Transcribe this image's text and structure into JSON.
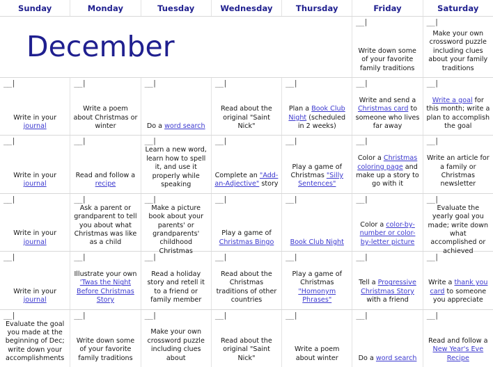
{
  "title": "December",
  "weekday_headers": [
    "Sunday",
    "Monday",
    "Tuesday",
    "Wednesday",
    "Thursday",
    "Friday",
    "Saturday"
  ],
  "date_marker": "__|",
  "colors": {
    "title": "#1f1f8f",
    "weekday_header": "#1f1f8f",
    "link": "#3b38cf",
    "body_text": "#151515",
    "grid_line": "#d8d8d8",
    "background": "#ffffff"
  },
  "weeks": [
    {
      "title_span": true,
      "days": [
        {
          "has_date": false,
          "parts": []
        },
        {
          "has_date": false,
          "parts": []
        },
        {
          "has_date": false,
          "parts": []
        },
        {
          "has_date": false,
          "parts": []
        },
        {
          "has_date": false,
          "parts": []
        },
        {
          "has_date": true,
          "parts": [
            {
              "t": "Write down some of your favorite family traditions",
              "link": false
            }
          ]
        },
        {
          "has_date": true,
          "parts": [
            {
              "t": "Make your own crossword puzzle including clues about your family traditions",
              "link": false
            }
          ]
        }
      ]
    },
    {
      "title_span": false,
      "days": [
        {
          "has_date": true,
          "parts": [
            {
              "t": "Write in your ",
              "link": false
            },
            {
              "t": "journal",
              "link": true
            }
          ]
        },
        {
          "has_date": true,
          "parts": [
            {
              "t": "Write a poem about Christmas or winter",
              "link": false
            }
          ]
        },
        {
          "has_date": true,
          "parts": [
            {
              "t": "Do a ",
              "link": false
            },
            {
              "t": "word search",
              "link": true
            }
          ]
        },
        {
          "has_date": true,
          "parts": [
            {
              "t": "Read about the original \"Saint Nick\"",
              "link": false
            }
          ]
        },
        {
          "has_date": true,
          "parts": [
            {
              "t": "Plan a ",
              "link": false
            },
            {
              "t": "Book Club Night",
              "link": true
            },
            {
              "t": " (scheduled in 2 weeks)",
              "link": false
            }
          ]
        },
        {
          "has_date": true,
          "parts": [
            {
              "t": "Write and send a ",
              "link": false
            },
            {
              "t": "Christmas card",
              "link": true
            },
            {
              "t": " to someone who lives far away",
              "link": false
            }
          ]
        },
        {
          "has_date": true,
          "parts": [
            {
              "t": "Write a goal",
              "link": true
            },
            {
              "t": " for this month; write a plan to accomplish the goal",
              "link": false
            }
          ]
        }
      ]
    },
    {
      "title_span": false,
      "days": [
        {
          "has_date": true,
          "parts": [
            {
              "t": "Write in your ",
              "link": false
            },
            {
              "t": "journal",
              "link": true
            }
          ]
        },
        {
          "has_date": true,
          "parts": [
            {
              "t": "Read and follow a ",
              "link": false
            },
            {
              "t": "recipe",
              "link": true
            }
          ]
        },
        {
          "has_date": true,
          "parts": [
            {
              "t": "Learn a new word, learn how to spell it, and use it properly while speaking",
              "link": false
            }
          ]
        },
        {
          "has_date": true,
          "parts": [
            {
              "t": "Complete an ",
              "link": false
            },
            {
              "t": "\"Add-an-Adjective\"",
              "link": true
            },
            {
              "t": " story",
              "link": false
            }
          ]
        },
        {
          "has_date": true,
          "parts": [
            {
              "t": "Play a game of Christmas ",
              "link": false
            },
            {
              "t": "\"Silly Sentences\"",
              "link": true
            }
          ]
        },
        {
          "has_date": true,
          "parts": [
            {
              "t": "Color a ",
              "link": false
            },
            {
              "t": "Christmas coloring page",
              "link": true
            },
            {
              "t": " and make up a story to go with it",
              "link": false
            }
          ]
        },
        {
          "has_date": true,
          "parts": [
            {
              "t": "Write an article for a family or Christmas newsletter",
              "link": false
            }
          ]
        }
      ]
    },
    {
      "title_span": false,
      "days": [
        {
          "has_date": true,
          "parts": [
            {
              "t": "Write in your ",
              "link": false
            },
            {
              "t": "journal",
              "link": true
            }
          ]
        },
        {
          "has_date": true,
          "parts": [
            {
              "t": "Ask a parent or grandparent to tell you about what Christmas was like as a child",
              "link": false
            }
          ]
        },
        {
          "has_date": true,
          "parts": [
            {
              "t": "Make a picture book about your parents' or grandparents' childhood Christmas",
              "link": false
            }
          ]
        },
        {
          "has_date": true,
          "parts": [
            {
              "t": "Play a game of ",
              "link": false
            },
            {
              "t": "Christmas Bingo",
              "link": true
            }
          ]
        },
        {
          "has_date": true,
          "parts": [
            {
              "t": "Book Club Night",
              "link": true
            }
          ]
        },
        {
          "has_date": true,
          "parts": [
            {
              "t": "Color a ",
              "link": false
            },
            {
              "t": "color-by-number or color-by-letter picture",
              "link": true
            }
          ]
        },
        {
          "has_date": true,
          "parts": [
            {
              "t": "Evaluate the yearly goal you made; write down what accomplished or achieved",
              "link": false
            }
          ]
        }
      ]
    },
    {
      "title_span": false,
      "days": [
        {
          "has_date": true,
          "parts": [
            {
              "t": "Write in your ",
              "link": false
            },
            {
              "t": "journal",
              "link": true
            }
          ]
        },
        {
          "has_date": true,
          "parts": [
            {
              "t": "Illustrate your own ",
              "link": false
            },
            {
              "t": "'Twas the Night Before Christmas Story",
              "link": true
            }
          ]
        },
        {
          "has_date": true,
          "parts": [
            {
              "t": "Read a holiday story and retell it to a friend or family member",
              "link": false
            }
          ]
        },
        {
          "has_date": true,
          "parts": [
            {
              "t": "Read about the Christmas traditions of other countries",
              "link": false
            }
          ]
        },
        {
          "has_date": true,
          "parts": [
            {
              "t": "Play a game of Christmas ",
              "link": false
            },
            {
              "t": "\"Homonym Phrases\"",
              "link": true
            }
          ]
        },
        {
          "has_date": true,
          "parts": [
            {
              "t": "Tell a ",
              "link": false
            },
            {
              "t": "Progressive Christmas Story",
              "link": true
            },
            {
              "t": " with a friend",
              "link": false
            }
          ]
        },
        {
          "has_date": true,
          "parts": [
            {
              "t": "Write a ",
              "link": false
            },
            {
              "t": "thank you card",
              "link": true
            },
            {
              "t": " to someone you appreciate",
              "link": false
            }
          ]
        }
      ]
    },
    {
      "title_span": false,
      "days": [
        {
          "has_date": true,
          "parts": [
            {
              "t": "Evaluate the goal you made at the beginning of Dec; write down your accomplishments",
              "link": false
            }
          ]
        },
        {
          "has_date": true,
          "parts": [
            {
              "t": "Write down some of your favorite family traditions",
              "link": false
            }
          ]
        },
        {
          "has_date": true,
          "parts": [
            {
              "t": "Make your own crossword puzzle including clues about",
              "link": false
            }
          ]
        },
        {
          "has_date": true,
          "parts": [
            {
              "t": "Read about the original \"Saint Nick\"",
              "link": false
            }
          ]
        },
        {
          "has_date": true,
          "parts": [
            {
              "t": "Write a poem about winter",
              "link": false
            }
          ]
        },
        {
          "has_date": true,
          "parts": [
            {
              "t": "Do a ",
              "link": false
            },
            {
              "t": "word search",
              "link": true
            }
          ]
        },
        {
          "has_date": true,
          "parts": [
            {
              "t": "Read and follow a ",
              "link": false
            },
            {
              "t": "New Year's Eve Recipe",
              "link": true
            }
          ]
        }
      ]
    }
  ]
}
